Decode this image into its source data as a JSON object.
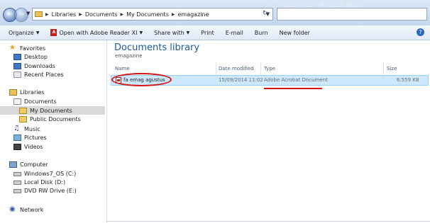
{
  "titlebar": {
    "title": "Documents - Microsoft Word",
    "breadcrumbs": [
      "Libraries",
      "Documents",
      "My Documents",
      "emagazine"
    ]
  },
  "toolbar": {
    "organize": "Organize",
    "open_with": "Open with Adobe Reader XI",
    "share_with": "Share with",
    "print": "Print",
    "email": "E-mail",
    "burn": "Burn",
    "new_folder": "New folder"
  },
  "navpane": {
    "favorites": "Favorites",
    "desktop": "Desktop",
    "downloads": "Downloads",
    "recent": "Recent Places",
    "libraries": "Libraries",
    "documents": "Documents",
    "my_documents": "My Documents",
    "public_documents": "Public Documents",
    "music": "Music",
    "pictures": "Pictures",
    "videos": "Videos",
    "computer": "Computer",
    "drive_c": "Windows7_OS (C:)",
    "drive_d": "Local Disk (D:)",
    "drive_e": "DVD RW Drive (E:)",
    "network": "Network"
  },
  "content": {
    "title": "Documents library",
    "subtitle": "emagazine",
    "columns": {
      "name": "Name",
      "date": "Date modified",
      "type": "Type",
      "size": "Size"
    },
    "file": {
      "name": "fa emag agustus",
      "date": "15/09/2014 11:02",
      "type": "Adobe Acrobat Document",
      "size": "6.559 KB"
    }
  },
  "colors": {
    "accent_title": "#1b5a9c",
    "annotation_red": "#d61414",
    "selection": "#cce8ff"
  }
}
